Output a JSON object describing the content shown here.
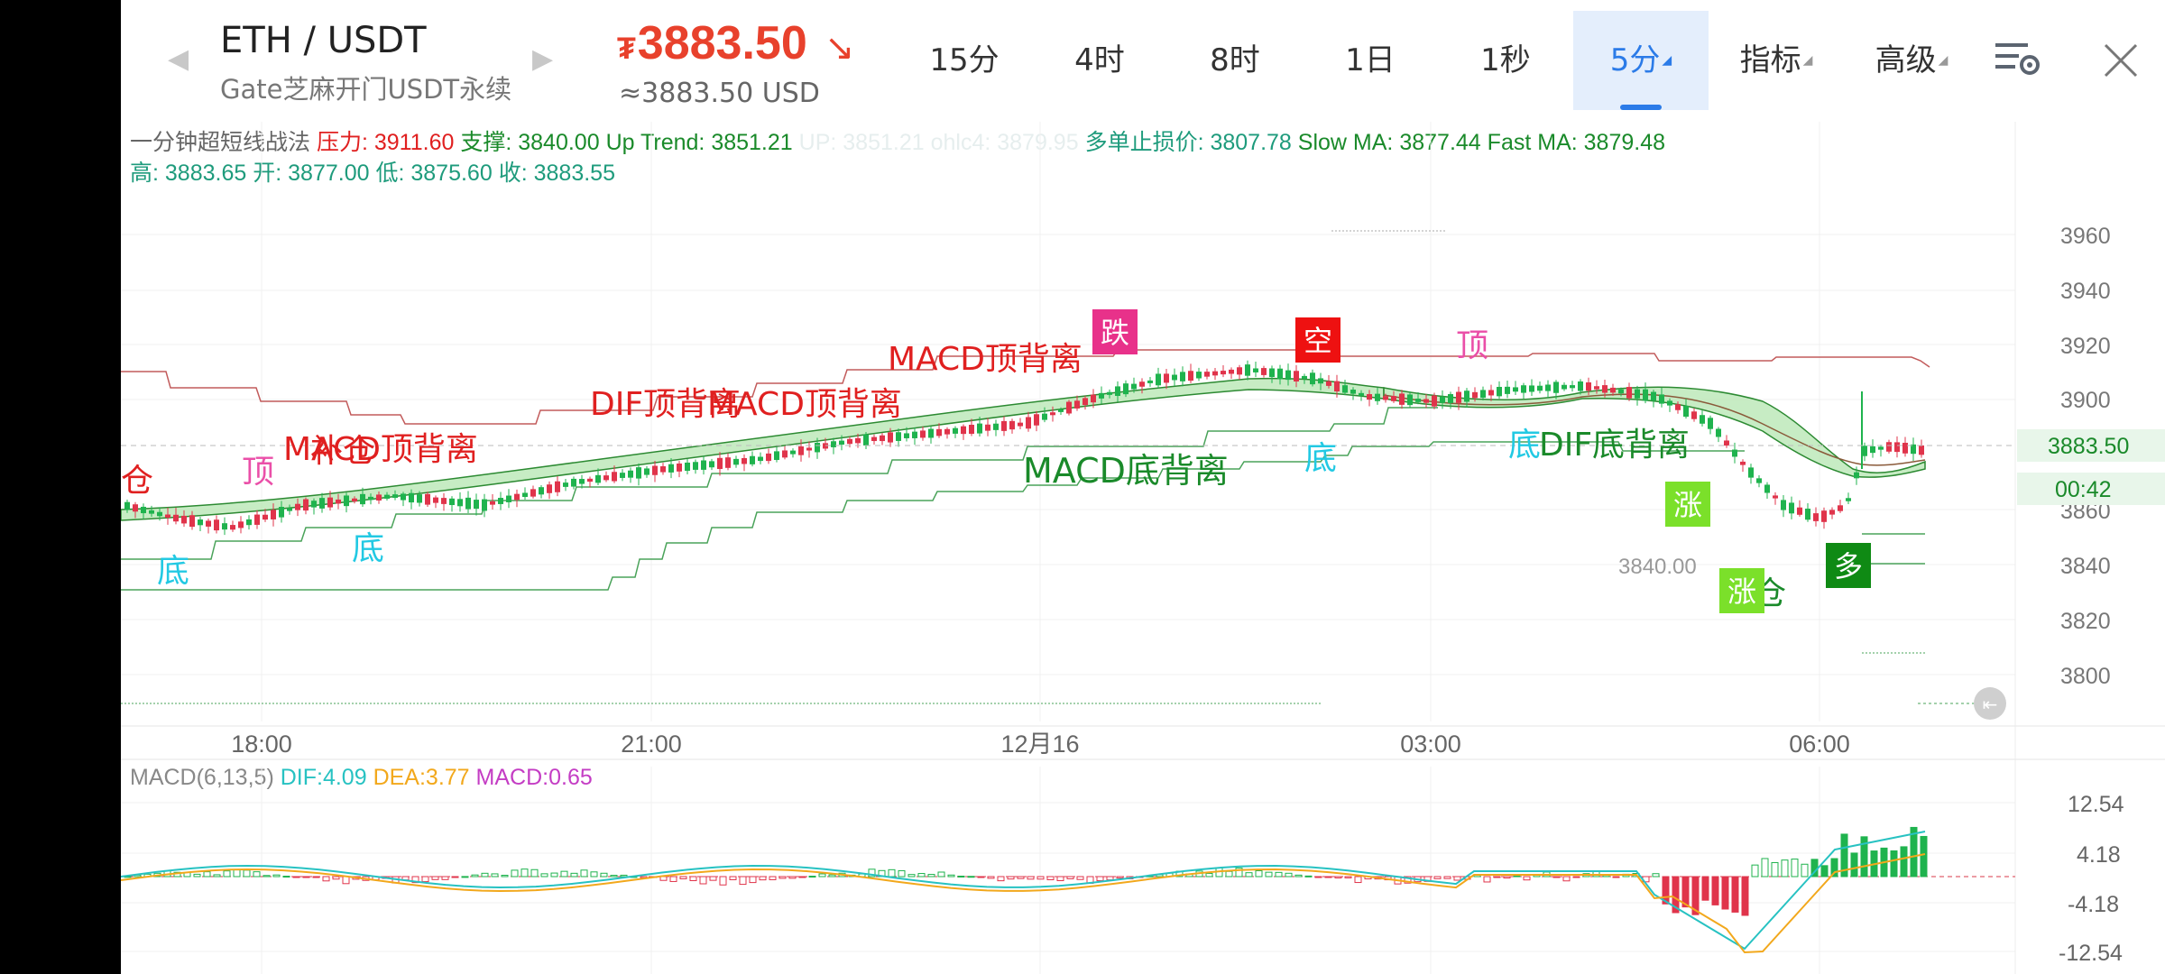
{
  "header": {
    "pair": "ETH / USDT",
    "subtitle": "Gate芝麻开门USDT永续",
    "currency_symbol": "₮",
    "price": "3883.50",
    "price_usd": "≈3883.50 USD",
    "price_color": "#e8412c"
  },
  "tabs": [
    {
      "label": "15分"
    },
    {
      "label": "4时"
    },
    {
      "label": "8时"
    },
    {
      "label": "1日"
    },
    {
      "label": "1秒"
    },
    {
      "label": "5分",
      "active": true
    },
    {
      "label": "指标"
    },
    {
      "label": "高级"
    }
  ],
  "icons": {
    "settings": "chart-settings-icon",
    "close": "close-icon",
    "prev": "chevron-left-icon",
    "next": "chevron-right-icon"
  },
  "indicator": {
    "name": "一分钟超短线战法",
    "pressure_label": "压力:",
    "pressure_value": "3911.60",
    "support_label": "支撑:",
    "support_value": "3840.00",
    "uptrend_label": "Up Trend:",
    "uptrend_value": "3851.21",
    "faint_text": "UP: 3851.21 ohlc4: 3879.95",
    "stoploss_label": "多单止损价:",
    "stoploss_value": "3807.78",
    "slowma_label": "Slow MA:",
    "slowma_value": "3877.44",
    "fastma_label": "Fast MA:",
    "fastma_value": "3879.48"
  },
  "ohlc": {
    "high_label": "高:",
    "high": "3883.65",
    "open_label": "开:",
    "open": "3877.00",
    "low_label": "低:",
    "low": "3875.60",
    "close_label": "收:",
    "close": "3883.55"
  },
  "price_axis": [
    "3960",
    "3940",
    "3920",
    "3900",
    "3860",
    "3840",
    "3820",
    "3800"
  ],
  "current_price_tag": "3883.50",
  "countdown_tag": "00:42",
  "support_line_label": "3840.00",
  "time_axis": [
    "18:00",
    "21:00",
    "12月16",
    "03:00",
    "06:00"
  ],
  "annotations": [
    {
      "text": "MACD顶背离",
      "color": "#e02020"
    },
    {
      "text": "DIF顶背离",
      "color": "#e02020"
    },
    {
      "text": "MACD顶背离",
      "color": "#e02020"
    },
    {
      "text": "MACD顶背离",
      "color": "#e02020"
    },
    {
      "text": "MACD底背离",
      "color": "#1a8a2a"
    },
    {
      "text": "DIF底背离",
      "color": "#1a8a2a"
    },
    {
      "text": "顶",
      "color": "#ea4fa8"
    },
    {
      "text": "顶",
      "color": "#ea4fa8"
    },
    {
      "text": "底",
      "color": "#22c9e3"
    },
    {
      "text": "底",
      "color": "#22c9e3"
    },
    {
      "text": "底",
      "color": "#22c9e3"
    },
    {
      "text": "底",
      "color": "#22c9e3"
    },
    {
      "text": "补仓",
      "color": "#e02020"
    },
    {
      "text": "仓",
      "color": "#e02020"
    },
    {
      "text": "仓",
      "color": "#1a8a2a"
    }
  ],
  "badges": [
    {
      "text": "跌",
      "bg": "#e8318a"
    },
    {
      "text": "空",
      "bg": "#ee1111"
    },
    {
      "text": "涨",
      "bg": "#7be02a"
    },
    {
      "text": "涨",
      "bg": "#7be02a"
    },
    {
      "text": "多",
      "bg": "#0f8a14"
    }
  ],
  "macd": {
    "name": "MACD(6,13,5)",
    "dif_label": "DIF:",
    "dif": "4.09",
    "dea_label": "DEA:",
    "dea": "3.77",
    "macd_label": "MACD:",
    "macd": "0.65",
    "axis": [
      "12.54",
      "4.18",
      "-4.18",
      "-12.54"
    ]
  },
  "colors": {
    "up": "#1fb34e",
    "down": "#e0344b",
    "dif": "#27c2c2",
    "dea": "#f2a81c",
    "macd": "#c43dc4"
  }
}
